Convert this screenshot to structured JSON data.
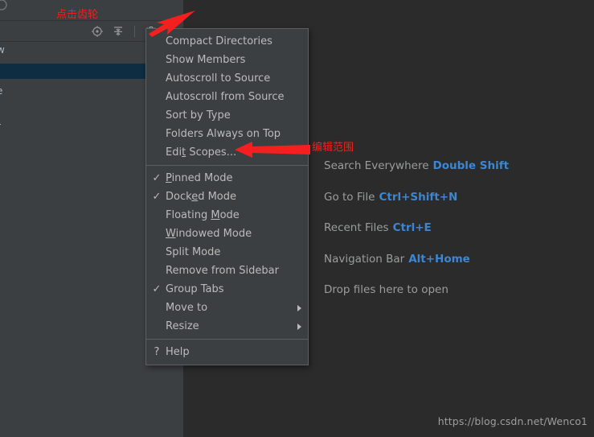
{
  "app": {
    "theme_bg": "#3c3f41",
    "editor_bg": "#2b2b2b",
    "accent_blue": "#3d86d1",
    "selection_bg": "#0e2c42",
    "annotation_color": "#f02020"
  },
  "project_panel": {
    "toolbar_icons": [
      {
        "name": "locate-target-icon",
        "glyph": "locate"
      },
      {
        "name": "collapse-all-icon",
        "glyph": "collapse"
      },
      {
        "name": "settings-gear-icon",
        "glyph": "gear"
      },
      {
        "name": "hide-panel-icon",
        "glyph": "minimize"
      }
    ],
    "tree_rows": [
      {
        "label": "w",
        "selected": false
      },
      {
        "label": "",
        "selected": true
      },
      {
        "label": "e",
        "selected": false
      },
      {
        "label": "r",
        "selected": false
      }
    ]
  },
  "popup_menu": {
    "items": [
      {
        "label": "Compact Directories",
        "checked": false,
        "mnemonic": "",
        "submenu": false,
        "type": "item"
      },
      {
        "label": "Show Members",
        "checked": false,
        "mnemonic": "",
        "submenu": false,
        "type": "item"
      },
      {
        "label": "Autoscroll to Source",
        "checked": false,
        "mnemonic": "",
        "submenu": false,
        "type": "item"
      },
      {
        "label": "Autoscroll from Source",
        "checked": false,
        "mnemonic": "",
        "submenu": false,
        "type": "item"
      },
      {
        "label": "Sort by Type",
        "checked": false,
        "mnemonic": "",
        "submenu": false,
        "type": "item"
      },
      {
        "label": "Folders Always on Top",
        "checked": false,
        "mnemonic": "",
        "submenu": false,
        "type": "item"
      },
      {
        "label": "Edit Scopes...",
        "checked": false,
        "mnemonic": "t",
        "submenu": false,
        "type": "item"
      },
      {
        "type": "separator"
      },
      {
        "label": "Pinned Mode",
        "checked": true,
        "mnemonic": "P",
        "submenu": false,
        "type": "item"
      },
      {
        "label": "Docked Mode",
        "checked": true,
        "mnemonic": "e",
        "submenu": false,
        "type": "item"
      },
      {
        "label": "Floating Mode",
        "checked": false,
        "mnemonic": "M",
        "submenu": false,
        "type": "item"
      },
      {
        "label": "Windowed Mode",
        "checked": false,
        "mnemonic": "W",
        "submenu": false,
        "type": "item"
      },
      {
        "label": "Split Mode",
        "checked": false,
        "mnemonic": "",
        "submenu": false,
        "type": "item"
      },
      {
        "label": "Remove from Sidebar",
        "checked": false,
        "mnemonic": "",
        "submenu": false,
        "type": "item"
      },
      {
        "label": "Group Tabs",
        "checked": true,
        "mnemonic": "",
        "submenu": false,
        "type": "item"
      },
      {
        "label": "Move to",
        "checked": false,
        "mnemonic": "",
        "submenu": true,
        "type": "item"
      },
      {
        "label": "Resize",
        "checked": false,
        "mnemonic": "",
        "submenu": true,
        "type": "item"
      },
      {
        "type": "separator"
      },
      {
        "label": "Help",
        "checked": false,
        "mnemonic": "",
        "submenu": false,
        "type": "help"
      }
    ]
  },
  "editor_hints": {
    "rows": [
      {
        "action": "Search Everywhere",
        "shortcut": "Double Shift"
      },
      {
        "action": "Go to File",
        "shortcut": "Ctrl+Shift+N"
      },
      {
        "action": "Recent Files",
        "shortcut": "Ctrl+E"
      },
      {
        "action": "Navigation Bar",
        "shortcut": "Alt+Home"
      },
      {
        "action": "Drop files here to open",
        "shortcut": ""
      }
    ],
    "watermark": "https://blog.csdn.net/Wenco1"
  },
  "annotations": [
    {
      "name": "annotation-click-gear",
      "text": "点击齿轮"
    },
    {
      "name": "annotation-edit-scopes",
      "text": "编辑范围"
    }
  ]
}
